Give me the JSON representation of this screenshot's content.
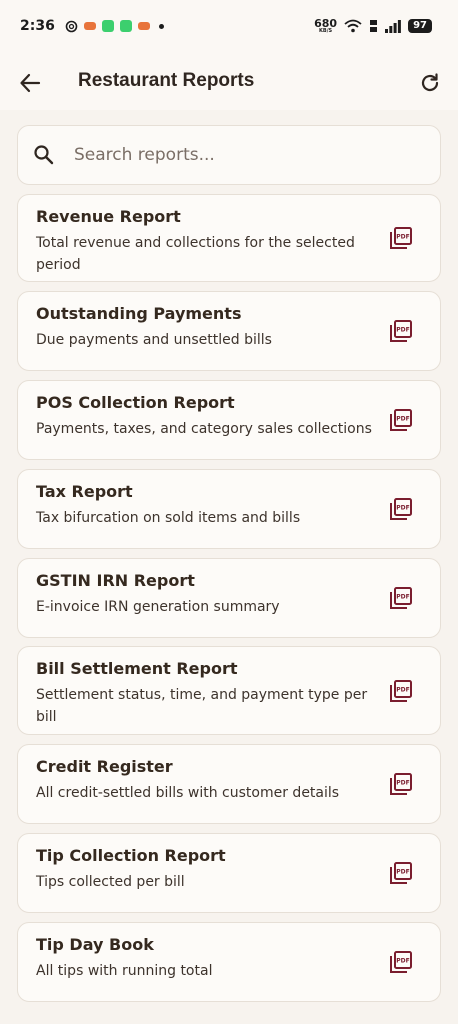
{
  "status_bar": {
    "time": "2:36",
    "net_speed": "680",
    "net_unit": "KB/S",
    "battery": "97"
  },
  "app_bar": {
    "title": "Restaurant Reports",
    "back_icon": "arrow-back-icon",
    "refresh_icon": "refresh-icon"
  },
  "search": {
    "placeholder": "Search reports...",
    "value": ""
  },
  "colors": {
    "accent": "#7a1d2e",
    "background": "#f7f3ee",
    "card": "#fdfbf8"
  },
  "reports": [
    {
      "title": "Revenue Report",
      "description": "Total revenue and collections for the selected period",
      "icon": "pdf-icon"
    },
    {
      "title": "Outstanding Payments",
      "description": "Due payments and unsettled bills",
      "icon": "pdf-icon"
    },
    {
      "title": "POS Collection Report",
      "description": "Payments, taxes, and category sales collections",
      "icon": "pdf-icon"
    },
    {
      "title": "Tax Report",
      "description": "Tax bifurcation on sold items and bills",
      "icon": "pdf-icon"
    },
    {
      "title": "GSTIN IRN Report",
      "description": "E-invoice IRN generation summary",
      "icon": "pdf-icon"
    },
    {
      "title": "Bill Settlement Report",
      "description": "Settlement status, time, and payment type per bill",
      "icon": "pdf-icon"
    },
    {
      "title": "Credit Register",
      "description": "All credit-settled bills with customer details",
      "icon": "pdf-icon"
    },
    {
      "title": "Tip Collection Report",
      "description": "Tips collected per bill",
      "icon": "pdf-icon"
    },
    {
      "title": "Tip Day Book",
      "description": "All tips with running total",
      "icon": "pdf-icon"
    }
  ]
}
